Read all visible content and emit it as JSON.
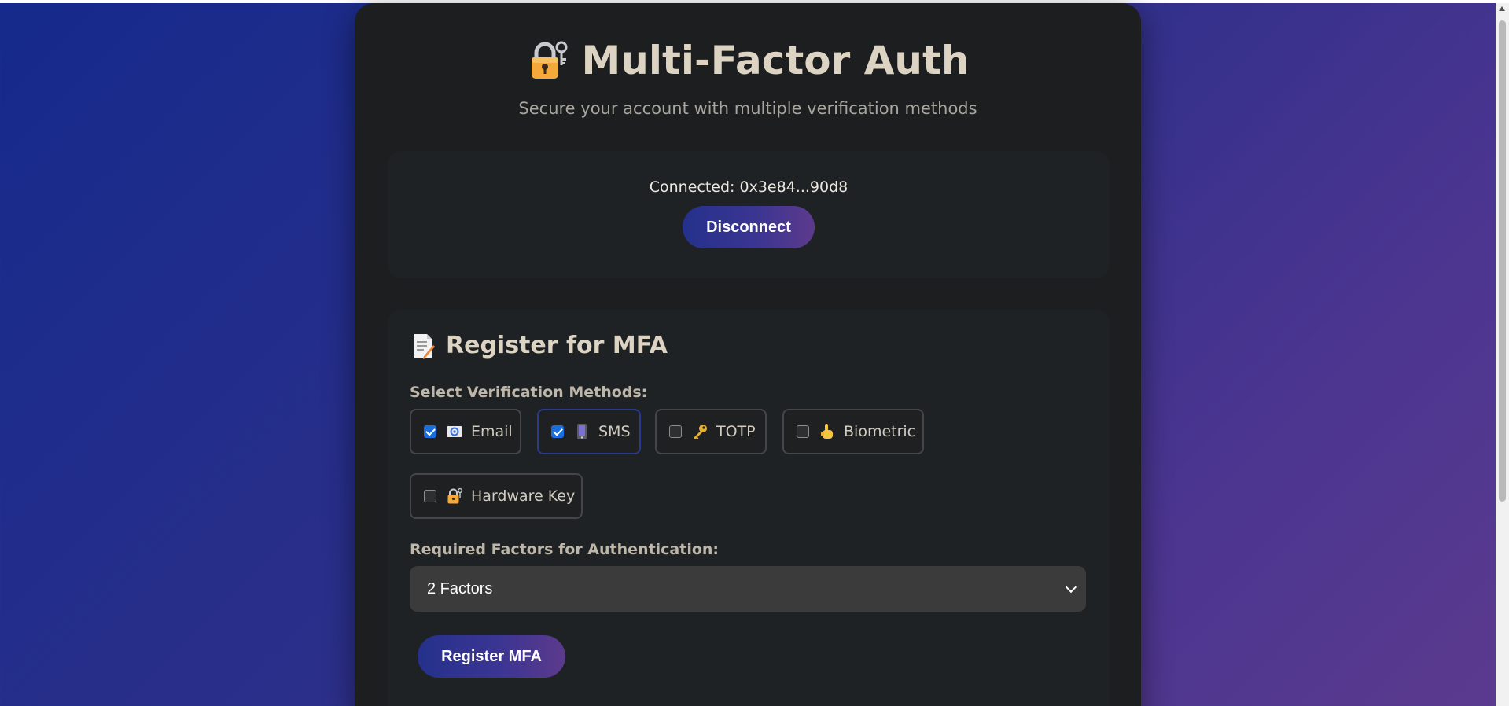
{
  "header": {
    "title": "Multi-Factor Auth",
    "title_icon": "lock-with-key-icon",
    "subtitle": "Secure your account with multiple verification methods"
  },
  "wallet": {
    "connected_text": "Connected: 0x3e84...90d8",
    "disconnect_label": "Disconnect"
  },
  "register": {
    "section_icon": "document-pencil-icon",
    "section_title": "Register for MFA",
    "methods_label": "Select Verification Methods:",
    "methods": [
      {
        "label": "Email",
        "icon": "email-icon",
        "checked": true
      },
      {
        "label": "SMS",
        "icon": "phone-icon",
        "checked": true
      },
      {
        "label": "TOTP",
        "icon": "key-icon",
        "checked": false
      },
      {
        "label": "Biometric",
        "icon": "pointing-hand-icon",
        "checked": false
      },
      {
        "label": "Hardware Key",
        "icon": "lock-with-key-icon",
        "checked": false
      }
    ],
    "factors_label": "Required Factors for Authentication:",
    "factors_selected": "2 Factors",
    "register_label": "Register MFA"
  },
  "colors": {
    "accent_gradient_start": "#24318c",
    "accent_gradient_end": "#5c3a8c",
    "checkbox_checked": "#1a6fe0",
    "card_background": "#1d1e20"
  }
}
